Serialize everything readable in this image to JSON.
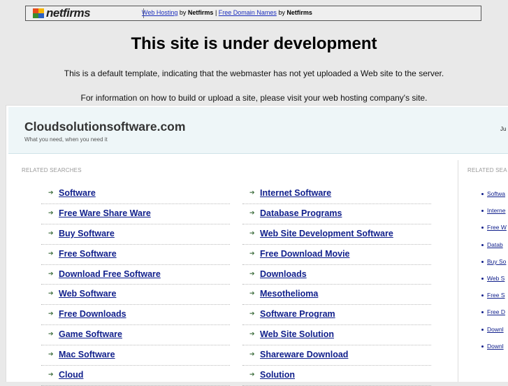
{
  "topbar": {
    "logo_text": "netfirms",
    "link1": "Web Hosting",
    "by1": "by",
    "brand1": "Netfirms",
    "sep": "|",
    "link2": "Free Domain Names",
    "by2": "by",
    "brand2": "Netfirms"
  },
  "notice": {
    "title": "This site is under development",
    "line1": "This is a default template, indicating that the webmaster has not yet uploaded a Web site to the server.",
    "line2": "For information on how to build or upload a site, please visit your web hosting company's site."
  },
  "frame": {
    "site_name": "Cloudsolutionsoftware.com",
    "tagline": "What you need, when you need it",
    "header_right": "Ju",
    "related_left_label": "RELATED SEARCHES",
    "related_right_label": "RELATED SEA",
    "left_links": [
      "Software",
      "Free Ware Share Ware",
      "Buy Software",
      "Free Software",
      "Download Free Software",
      "Web Software",
      "Free Downloads",
      "Game Software",
      "Mac Software",
      "Cloud"
    ],
    "mid_links": [
      "Internet Software",
      "Database Programs",
      "Web Site Development Software",
      "Free Download Movie",
      "Downloads",
      "Mesothelioma",
      "Software Program",
      "Web Site Solution",
      "Shareware Download",
      "Solution"
    ],
    "right_links": [
      "Softwa",
      "Interne",
      "Free W",
      "Datab",
      "Buy So",
      "Web S",
      "Free S",
      "Free D",
      "Downl",
      "Downl"
    ]
  },
  "colors": {
    "link": "#11208c",
    "header_bg": "#eef6f8",
    "page_bg": "#e9e9e9"
  }
}
